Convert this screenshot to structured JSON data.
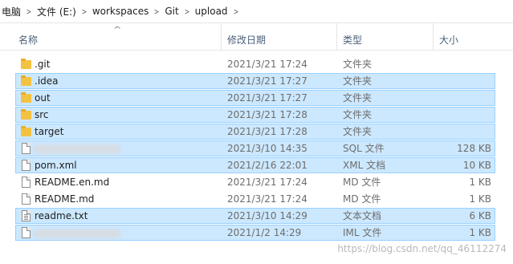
{
  "breadcrumb": [
    "电脑",
    "文件 (E:)",
    "workspaces",
    "Git",
    "upload"
  ],
  "columns": {
    "name": "名称",
    "date": "修改日期",
    "type": "类型",
    "size": "大小"
  },
  "files": [
    {
      "name": ".git",
      "date": "2021/3/21 17:24",
      "type": "文件夹",
      "size": "",
      "icon": "folder-icon",
      "selected": false
    },
    {
      "name": ".idea",
      "date": "2021/3/21 17:27",
      "type": "文件夹",
      "size": "",
      "icon": "folder-icon",
      "selected": true
    },
    {
      "name": "out",
      "date": "2021/3/21 17:27",
      "type": "文件夹",
      "size": "",
      "icon": "folder-icon",
      "selected": true
    },
    {
      "name": "src",
      "date": "2021/3/21 17:28",
      "type": "文件夹",
      "size": "",
      "icon": "folder-icon",
      "selected": true
    },
    {
      "name": "target",
      "date": "2021/3/21 17:28",
      "type": "文件夹",
      "size": "",
      "icon": "folder-icon",
      "selected": true
    },
    {
      "name": "",
      "date": "2021/3/10 14:35",
      "type": "SQL 文件",
      "size": "128 KB",
      "icon": "file-icon",
      "selected": true,
      "blurred": true
    },
    {
      "name": "pom.xml",
      "date": "2021/2/16 22:01",
      "type": "XML 文档",
      "size": "10 KB",
      "icon": "file-icon",
      "selected": true
    },
    {
      "name": "README.en.md",
      "date": "2021/3/21 17:24",
      "type": "MD 文件",
      "size": "1 KB",
      "icon": "file-icon",
      "selected": false
    },
    {
      "name": "README.md",
      "date": "2021/3/21 17:24",
      "type": "MD 文件",
      "size": "1 KB",
      "icon": "file-icon",
      "selected": false
    },
    {
      "name": "readme.txt",
      "date": "2021/3/10 14:29",
      "type": "文本文档",
      "size": "6 KB",
      "icon": "text-file-icon",
      "selected": true
    },
    {
      "name": "",
      "date": "2021/1/2 14:29",
      "type": "IML 文件",
      "size": "1 KB",
      "icon": "file-icon",
      "selected": true,
      "blurred": true
    }
  ],
  "watermark": "https://blog.csdn.net/qq_46112274"
}
